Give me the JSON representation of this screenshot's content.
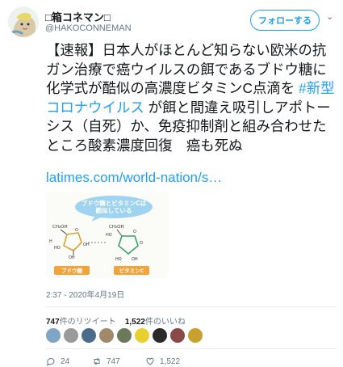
{
  "tweet": {
    "display_name": "□箱コネマン□",
    "handle": "@HAKOCONNEMAN",
    "follow_label": "フォローする",
    "caret": "⌄",
    "text_part1": "【速報】日本人がほとんど知らない欧米の抗ガン治療で癌ウイルスの餌であるブドウ糖に化学式が酷似の高濃度ビタミンC点滴を ",
    "hashtag": "#新型コロナウイルス",
    "text_part2": " が餌と間違え吸引しアポトーシス（自死）か、免疫抑制剤と組み合わせたところ酸素濃度回復　癌も死ぬ",
    "link": "latimes.com/world-nation/s…",
    "timestamp": "2:37 - 2020年4月19日",
    "retweets_count": "747",
    "retweets_label": "件のリツイート",
    "likes_count": "1,522",
    "likes_label": "件のいいね",
    "replies": "24",
    "retweets": "747",
    "likes": "1,522"
  },
  "image": {
    "bubble_text_1": "ブドウ糖とビタミンCは",
    "bubble_text_2": "酷似している",
    "label_left": "ブドウ糖",
    "label_right": "ビタミンC",
    "glucose_ch2oh": "CH₂OH",
    "vitc_ch2oh": "CH₂OH"
  },
  "colors": {
    "accent": "#1da1f2",
    "muted": "#657786",
    "bubble": "#9fd4f0",
    "label_left": "#f2a33a",
    "label_right": "#f2a33a",
    "ring_left": "#d9a33a",
    "ring_right": "#3aa06a"
  },
  "liker_colors": [
    "#7fa4c4",
    "#9a9a9a",
    "#4a6b8a",
    "#a08a6a",
    "#6b7a5a",
    "#e8d030",
    "#2a2a2a",
    "#8a4a4a",
    "#c8a030"
  ]
}
